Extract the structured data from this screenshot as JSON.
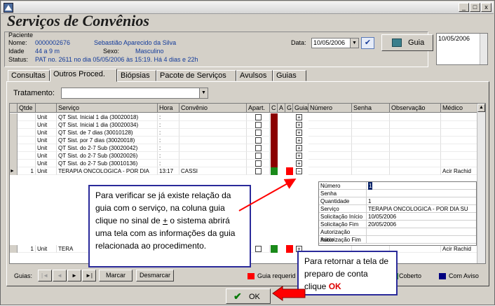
{
  "window": {
    "title_icon": "app-icon",
    "controls": [
      "_",
      "□",
      "x"
    ]
  },
  "page_title": "Serviços de Convênios",
  "patient": {
    "section_label": "Paciente",
    "name_label": "Nome:",
    "name_code": "0000002676",
    "name": "Sebastião Aparecido da Silva",
    "age_label": "Idade",
    "age": "44 a 9 m",
    "sex_label": "Sexo:",
    "sex": "Masculino",
    "status_label": "Status:",
    "status": "PAT no. 2611 no dia 05/05/2006  às  15:19. Há 4 dias e 22h"
  },
  "date": {
    "label": "Data:",
    "value": "10/05/2006",
    "check": "✔"
  },
  "guia_button": "Guia",
  "memo_date": "10/05/2006",
  "tabs": [
    "Consultas",
    "Outros Proced.",
    "Biópsias",
    "Pacote de Serviços",
    "Avulsos",
    "Guias"
  ],
  "tratamento_label": "Tratamento:",
  "table": {
    "columns": [
      "Qtde",
      "Serviço",
      "Hora",
      "Convênio",
      "Apart.",
      "C",
      "A",
      "G",
      "Guia",
      "Número",
      "Senha",
      "Observação",
      "Médico"
    ],
    "rows": [
      {
        "qtde": "",
        "unit": "Unit",
        "servico": "QT Sist. Inicial 1 dia (30020018)",
        "hora": ":",
        "convenio": "",
        "c": "#8b0000",
        "g": "",
        "medico": ""
      },
      {
        "qtde": "",
        "unit": "Unit",
        "servico": "QT Sist. Inicial 1 dia (30020034)",
        "hora": ":",
        "convenio": "",
        "c": "#8b0000",
        "g": "",
        "medico": ""
      },
      {
        "qtde": "",
        "unit": "Unit",
        "servico": "QT Sist. de 7 dias    (30010128)",
        "hora": ":",
        "convenio": "",
        "c": "#8b0000",
        "g": "",
        "medico": ""
      },
      {
        "qtde": "",
        "unit": "Unit",
        "servico": "QT Sist. por 7 dias   (30020018)",
        "hora": ":",
        "convenio": "",
        "c": "#8b0000",
        "g": "",
        "medico": ""
      },
      {
        "qtde": "",
        "unit": "Unit",
        "servico": "QT Sist. do 2-7 Sub  (30020042)",
        "hora": ":",
        "convenio": "",
        "c": "#8b0000",
        "g": "",
        "medico": ""
      },
      {
        "qtde": "",
        "unit": "Unit",
        "servico": "QT Sist. do 2-7 Sub  (30020026)",
        "hora": ":",
        "convenio": "",
        "c": "#8b0000",
        "g": "",
        "medico": ""
      },
      {
        "qtde": "",
        "unit": "Unit",
        "servico": "QT Sist. do 2-7 Sub  (30010136)",
        "hora": ":",
        "convenio": "",
        "c": "#8b0000",
        "g": "",
        "medico": ""
      },
      {
        "qtde": "1",
        "unit": "Unit",
        "servico": "TERAPIA ONCOLOGICA - POR DIA",
        "hora": "13:17",
        "convenio": "CASSI",
        "c": "#1a8a1a",
        "g": "#ff0000",
        "medico": "Acir Rachid"
      }
    ],
    "last_row": {
      "qtde": "1",
      "unit": "Unit",
      "servico": "TERA",
      "c": "#1a8a1a",
      "g": "#ff0000",
      "medico": "Acir Rachid"
    }
  },
  "detail": [
    {
      "k": "Número",
      "v": "1"
    },
    {
      "k": "Senha",
      "v": ""
    },
    {
      "k": "Quantidade",
      "v": "1"
    },
    {
      "k": "Serviço",
      "v": "TERAPIA ONCOLOGICA - POR DIA SU"
    },
    {
      "k": "Solicitação Início",
      "v": "10/05/2006"
    },
    {
      "k": "Solicitação Fim",
      "v": "20/05/2006"
    },
    {
      "k": "Autorização Início",
      "v": ""
    },
    {
      "k": "Autorização Fim",
      "v": ""
    }
  ],
  "callout1": {
    "before": "Para verificar se já existe relação da guia com o serviço, na coluna guia clique no sinal de ",
    "sign": "+",
    "after": " o sistema abrirá uma tela com as informações da guia relacionada ao procedimento."
  },
  "callout2": {
    "text": "Para retornar a tela de preparo de conta clique ",
    "ok": "OK"
  },
  "bottom": {
    "guias_label": "Guias:",
    "nav": [
      "|◄",
      "◄",
      "►",
      "►|"
    ],
    "mark": "Marcar",
    "unmark": "Desmarcar",
    "legend": [
      {
        "label": "Guia requerid",
        "color": "#ff0000"
      },
      {
        "label": "Coberto",
        "color": "#1a8a1a"
      },
      {
        "label": "Com Aviso",
        "color": "#000080"
      }
    ]
  },
  "ok_button": "OK",
  "colors": {
    "arrow": "#ff0000",
    "callout_border": "#2a2a9a"
  }
}
